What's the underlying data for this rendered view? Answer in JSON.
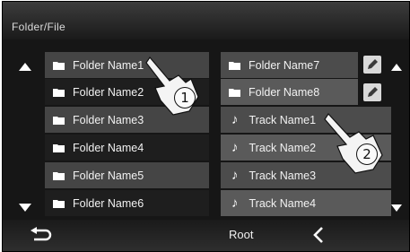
{
  "header": {
    "title": "Folder/File"
  },
  "left_list": [
    {
      "label": "Folder Name1"
    },
    {
      "label": "Folder Name2"
    },
    {
      "label": "Folder Name3"
    },
    {
      "label": "Folder Name4"
    },
    {
      "label": "Folder Name5"
    },
    {
      "label": "Folder Name6"
    }
  ],
  "right_list": [
    {
      "label": "Folder Name7",
      "kind": "folder"
    },
    {
      "label": "Folder Name8",
      "kind": "folder"
    },
    {
      "label": "Track Name1",
      "kind": "track"
    },
    {
      "label": "Track Name2",
      "kind": "track"
    },
    {
      "label": "Track Name3",
      "kind": "track"
    },
    {
      "label": "Track Name4",
      "kind": "track"
    }
  ],
  "footer": {
    "root_label": "Root"
  },
  "callouts": {
    "one": "1",
    "two": "2"
  },
  "colors": {
    "background": "#161616",
    "row_light": "#454545",
    "row_dark": "#1e1e1e",
    "text": "#f2f2f2"
  }
}
